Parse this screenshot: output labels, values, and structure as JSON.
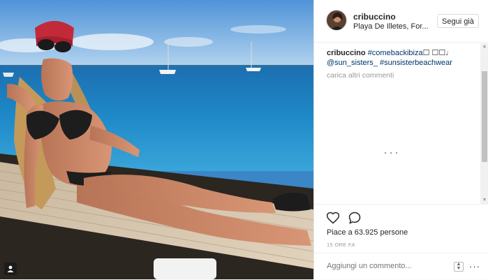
{
  "post": {
    "username": "cribuccino",
    "location": "Playa De Illetes, For...",
    "follow_label": "Segui già",
    "caption_user": "cribuccino",
    "caption_tag1": "#comebackibiza",
    "caption_emoji": "☐ ☐☐♩",
    "caption_mention": "@sun_sisters_",
    "caption_tag2": "#sunsisterbeachwear",
    "load_more": "carica altri commenti",
    "likes": "Piace a 63.925 persone",
    "time_ago": "15 ORE FA",
    "comment_placeholder": "Aggiungi un commento..."
  },
  "icons": [
    "user-tag-icon",
    "heart-icon",
    "comment-icon",
    "more-options-icon",
    "emoji-icon"
  ],
  "colors": {
    "link": "#003569",
    "muted": "#999999",
    "text": "#262626"
  }
}
